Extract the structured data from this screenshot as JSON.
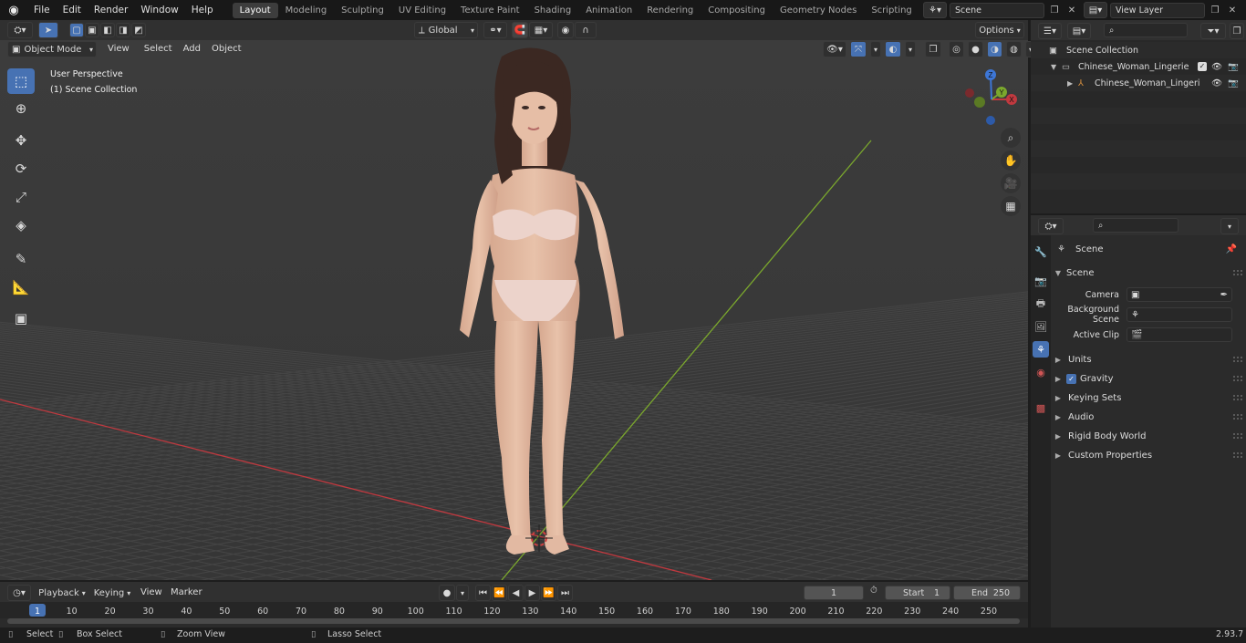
{
  "menu": {
    "items": [
      "File",
      "Edit",
      "Render",
      "Window",
      "Help"
    ]
  },
  "workspace_tabs": [
    "Layout",
    "Modeling",
    "Sculpting",
    "UV Editing",
    "Texture Paint",
    "Shading",
    "Animation",
    "Rendering",
    "Compositing",
    "Geometry Nodes",
    "Scripting"
  ],
  "active_tab": "Layout",
  "scene_field": "Scene",
  "view_layer_field": "View Layer",
  "viewport": {
    "mode": "Object Mode",
    "menus": [
      "View",
      "Select",
      "Add",
      "Object"
    ],
    "transform_orientation": "Global",
    "options_label": "Options",
    "overlay_title": "User Perspective",
    "overlay_subtitle": "(1) Scene Collection",
    "gizmo_labels": {
      "x": "X",
      "y": "Y",
      "z": "Z"
    }
  },
  "outliner": {
    "root": "Scene Collection",
    "collection": "Chinese_Woman_Lingerie",
    "object": "Chinese_Woman_Lingeri"
  },
  "properties": {
    "header": "Scene",
    "section": "Scene",
    "camera_label": "Camera",
    "background_scene_label": "Background Scene",
    "active_clip_label": "Active Clip",
    "panels": [
      "Units",
      "Gravity",
      "Keying Sets",
      "Audio",
      "Rigid Body World",
      "Custom Properties"
    ],
    "gravity_checked": true
  },
  "timeline": {
    "menus": [
      "Playback",
      "Keying",
      "View",
      "Marker"
    ],
    "current_frame": "1",
    "start_label": "Start",
    "start_value": "1",
    "end_label": "End",
    "end_value": "250",
    "ticks": [
      "1",
      "10",
      "20",
      "30",
      "40",
      "50",
      "60",
      "70",
      "80",
      "90",
      "100",
      "110",
      "120",
      "130",
      "140",
      "150",
      "160",
      "170",
      "180",
      "190",
      "200",
      "210",
      "220",
      "230",
      "240",
      "250"
    ]
  },
  "statusbar": {
    "select": "Select",
    "box_select": "Box Select",
    "zoom_view": "Zoom View",
    "lasso_select": "Lasso Select",
    "version": "2.93.7"
  },
  "colors": {
    "accent": "#4772b3",
    "x_axis": "#c0393f",
    "y_axis": "#7ba82d",
    "z_axis": "#3d76d6"
  }
}
